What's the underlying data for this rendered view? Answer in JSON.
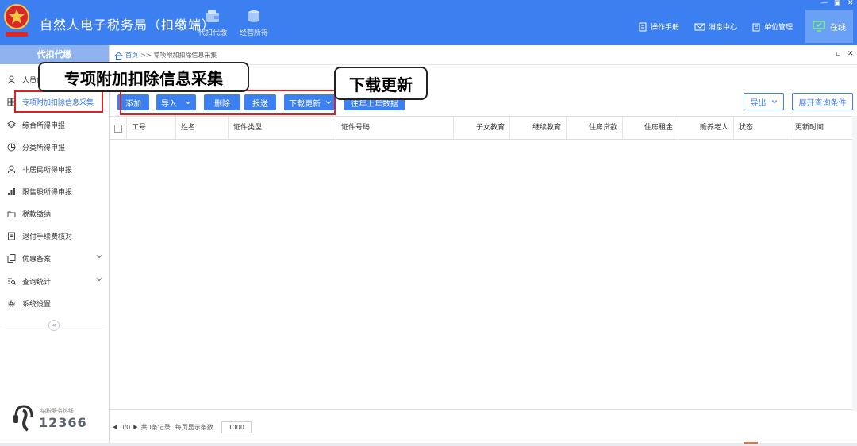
{
  "header": {
    "app_title": "自然人电子税务局（扣缴端）",
    "nav": [
      {
        "label": "代扣代缴"
      },
      {
        "label": "经营所得"
      }
    ],
    "links": [
      {
        "label": "操作手册"
      },
      {
        "label": "消息中心"
      },
      {
        "label": "单位管理"
      }
    ],
    "status": "在线"
  },
  "sidebar": {
    "title": "代扣代缴",
    "items": [
      {
        "label": "人员信息采集"
      },
      {
        "label": "专项附加扣除信息采集"
      },
      {
        "label": "综合所得申报"
      },
      {
        "label": "分类所得申报"
      },
      {
        "label": "非居民所得申报"
      },
      {
        "label": "限售股所得申报"
      },
      {
        "label": "税款缴纳"
      },
      {
        "label": "退付手续费核对"
      },
      {
        "label": "优惠备案"
      },
      {
        "label": "查询统计"
      },
      {
        "label": "系统设置"
      }
    ],
    "hotline_label": "纳税服务热线",
    "hotline_number": "12366"
  },
  "breadcrumb": {
    "home": "首页",
    "separator": ">>",
    "current": "专项附加扣除信息采集"
  },
  "toolbar": {
    "add": "添加",
    "import": "导入",
    "delete": "删除",
    "submit": "报送",
    "download_update": "下载更新",
    "transfer_last_year": "往年上年数据",
    "export": "导出",
    "expand_query": "展开查询条件"
  },
  "table": {
    "columns": [
      "工号",
      "姓名",
      "证件类型",
      "证件号码",
      "子女教育",
      "继续教育",
      "住房贷款",
      "住房租金",
      "赡养老人",
      "状态",
      "更新时间"
    ],
    "rows": []
  },
  "pager": {
    "page": "0/0",
    "total": "共0条记录",
    "per_page_label": "每页显示条数",
    "per_page": "1000"
  },
  "annotations": {
    "callout_1": "专项附加扣除信息采集",
    "callout_2": "下载更新"
  },
  "colors": {
    "header_bg": "#3c7ff0",
    "button_bg": "#3c7ff0",
    "highlight": "#e02020"
  }
}
